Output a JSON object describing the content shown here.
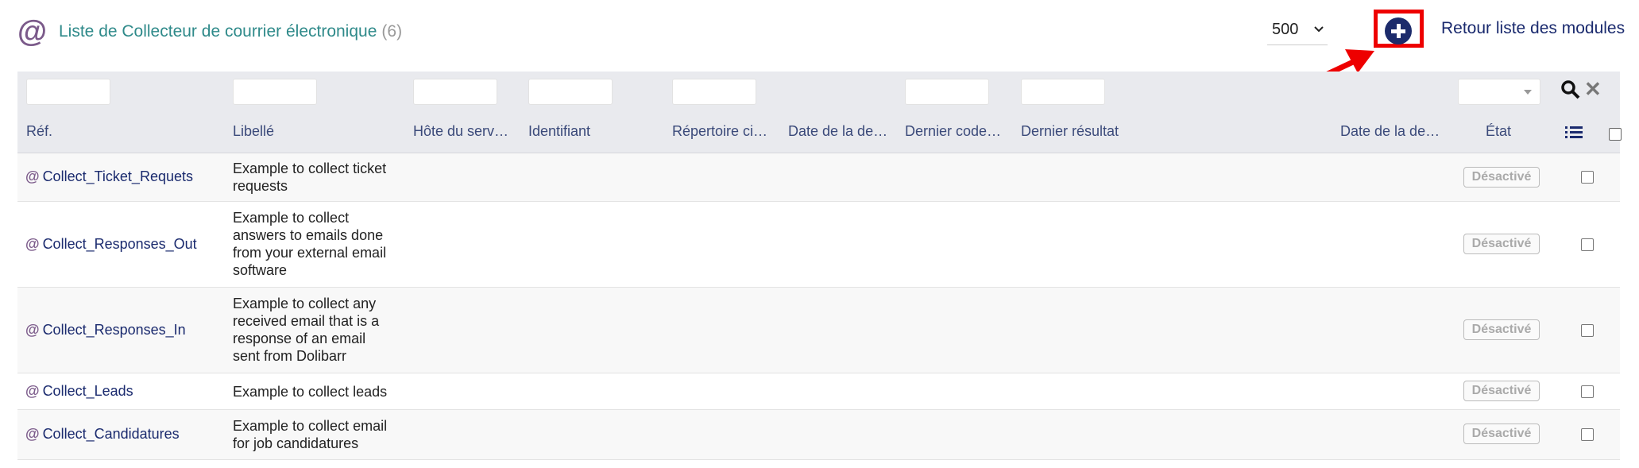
{
  "header": {
    "icon": "at-icon",
    "title": "Liste de Collecteur de courrier électronique",
    "count": "(6)",
    "limit_value": "500",
    "back_link": "Retour liste des modules"
  },
  "colors": {
    "accent_title": "#2f8a8a",
    "link": "#1a2a6e",
    "highlight_box": "#ee0000",
    "new_button": "#1c2b6b"
  },
  "columns": [
    "Réf.",
    "Libellé",
    "Hôte du serv…",
    "Identifiant",
    "Répertoire ci…",
    "Date de la de…",
    "Dernier code…",
    "Dernier résultat",
    "Date de la de…",
    "État"
  ],
  "rows": [
    {
      "ref": "Collect_Ticket_Requets",
      "label": [
        "Example to collect ticket",
        "requests"
      ],
      "status": "Désactivé"
    },
    {
      "ref": "Collect_Responses_Out",
      "label": [
        "Example to collect",
        "answers to emails done",
        "from your external email",
        "software"
      ],
      "status": "Désactivé"
    },
    {
      "ref": "Collect_Responses_In",
      "label": [
        "Example to collect any",
        "received email that is a",
        "response of an email",
        "sent from Dolibarr"
      ],
      "status": "Désactivé"
    },
    {
      "ref": "Collect_Leads",
      "label": [
        "Example to collect leads"
      ],
      "status": "Désactivé"
    },
    {
      "ref": "Collect_Candidatures",
      "label": [
        "Example to collect email",
        "for job candidatures"
      ],
      "status": "Désactivé"
    }
  ]
}
